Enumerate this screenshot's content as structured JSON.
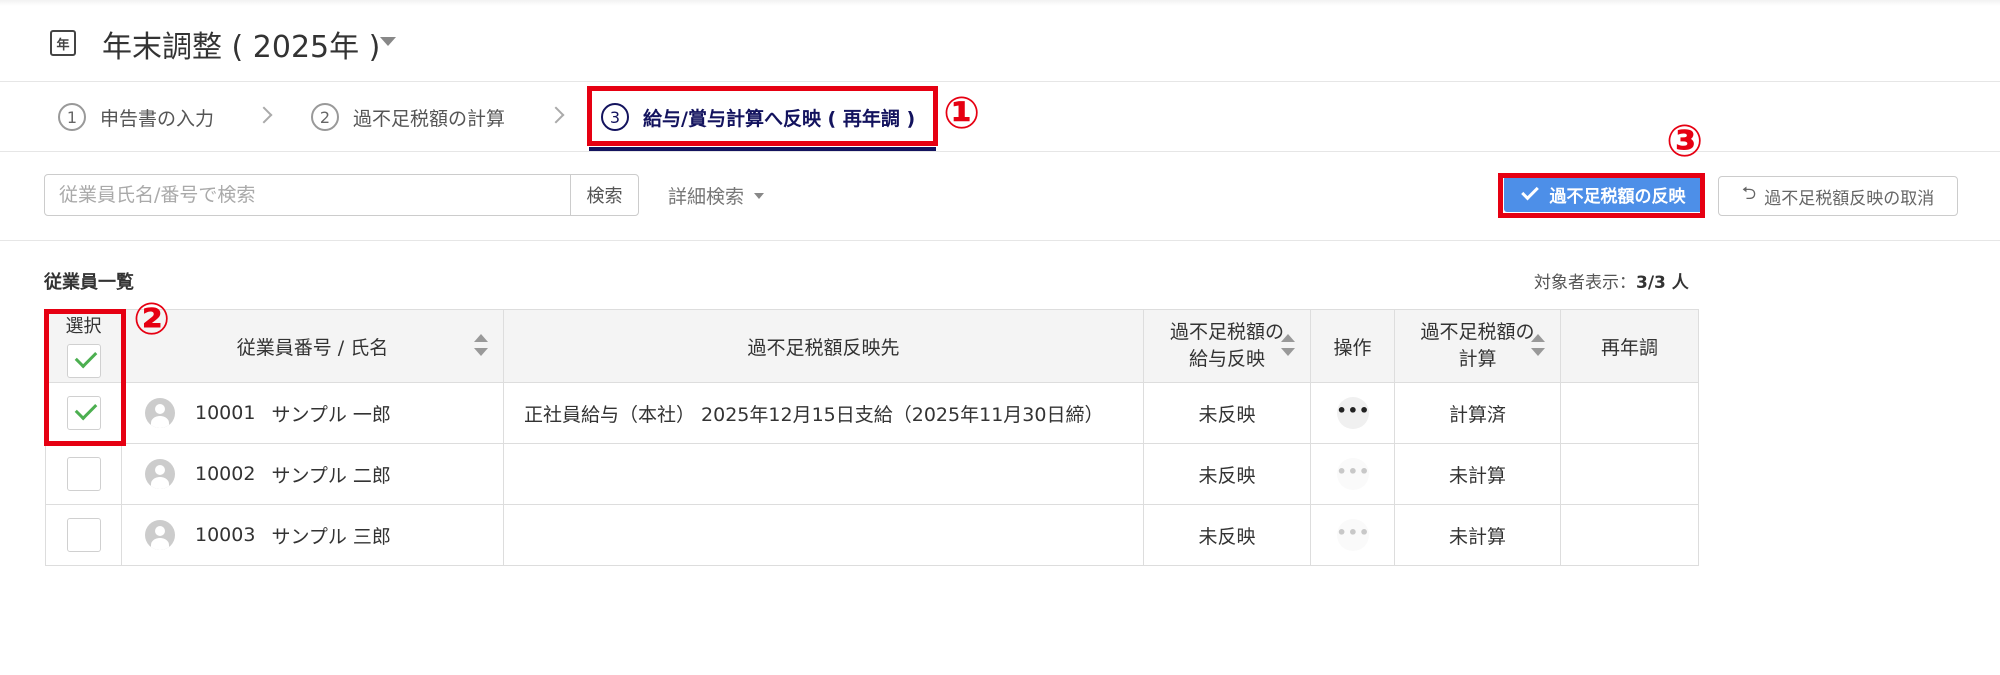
{
  "header": {
    "icon_label": "年",
    "title": "年末調整 ( 2025年 )"
  },
  "steps": [
    {
      "num": "1",
      "label": "申告書の入力"
    },
    {
      "num": "2",
      "label": "過不足税額の計算"
    },
    {
      "num": "3",
      "label": "給与/賞与計算へ反映 ( 再年調 )"
    }
  ],
  "annotations": {
    "a1": "①",
    "a2": "②",
    "a3": "③"
  },
  "toolbar": {
    "search_placeholder": "従業員氏名/番号で検索",
    "search_button": "検索",
    "advanced_search": "詳細検索",
    "reflect_button": "過不足税額の反映",
    "cancel_button": "過不足税額反映の取消"
  },
  "list": {
    "title": "従業員一覧",
    "count_label": "対象者表示：",
    "count_value": "3/3 人"
  },
  "table": {
    "headers": {
      "select": "選択",
      "employee": "従業員番号 / 氏名",
      "destination": "過不足税額反映先",
      "reflect_line1": "過不足税額の",
      "reflect_line2": "給与反映",
      "operation": "操作",
      "calc_line1": "過不足税額の",
      "calc_line2": "計算",
      "readjust": "再年調"
    },
    "rows": [
      {
        "emp_no": "10001",
        "name": "サンプル 一郎",
        "destination": "正社員給与（本社） 2025年12月15日支給（2025年11月30日締）",
        "reflect_status": "未反映",
        "calc_status": "計算済",
        "readjust": "",
        "ops": "•••",
        "checked": true
      },
      {
        "emp_no": "10002",
        "name": "サンプル 二郎",
        "destination": "",
        "reflect_status": "未反映",
        "calc_status": "未計算",
        "readjust": "",
        "ops": "•••",
        "checked": false
      },
      {
        "emp_no": "10003",
        "name": "サンプル 三郎",
        "destination": "",
        "reflect_status": "未反映",
        "calc_status": "未計算",
        "readjust": "",
        "ops": "•••",
        "checked": false
      }
    ]
  },
  "colors": {
    "accent_navy": "#13135e",
    "primary_button": "#4d8fe8",
    "status_red": "#e60012",
    "status_blue": "#2a6fc9",
    "annotation_red": "#e60012"
  }
}
